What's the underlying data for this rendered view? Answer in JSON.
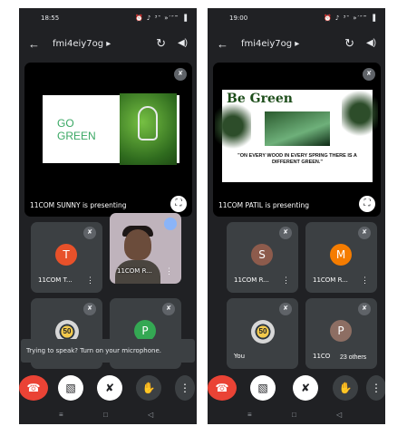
{
  "left": {
    "status": {
      "time": "18:55",
      "indicators": "⏰ ♪ ³‶ »′″‴ ▐"
    },
    "meeting_code": "fmi4eiy7og",
    "slide": {
      "line1": "GO",
      "line2": "GREEN"
    },
    "presenting_caption": "11COM SUNNY is presenting",
    "tiles": [
      {
        "avatar_letter": "T",
        "name": "11COM T...",
        "color": "#e8512a"
      },
      {
        "name": "11COM R...",
        "video": true
      },
      {
        "badge": "50",
        "name": ""
      },
      {
        "avatar_letter": "P",
        "name": "",
        "color": "#34a853"
      }
    ],
    "toast": "Trying to speak? Turn on your microphone."
  },
  "right": {
    "status": {
      "time": "19:00",
      "indicators": "⏰ ♪ ³‶ »′″‴ ▐"
    },
    "meeting_code": "fmi4eiy7og",
    "slide": {
      "title": "Be Green",
      "quote": "\"On every wood in every spring there is a different green.\""
    },
    "presenting_caption": "11COM PATIL is presenting",
    "tiles": [
      {
        "avatar_letter": "S",
        "name": "11COM R...",
        "color": "#8d5b4c"
      },
      {
        "avatar_letter": "M",
        "name": "11COM R...",
        "color": "#f57c00"
      },
      {
        "badge": "50",
        "name": "You"
      },
      {
        "avatar_letter": "P",
        "name": "11CO",
        "color": "#8d6e63",
        "others": "23 others"
      }
    ]
  },
  "icons": {
    "back": "←",
    "caret": "▸",
    "swap": "↻",
    "speaker": "◀)",
    "mic_off": "✘",
    "fullscreen": "⛶",
    "more": "⋮",
    "end": "☎",
    "cam_off": "▧",
    "mic": "✘",
    "hand": "✋",
    "nav_menu": "≡",
    "nav_home": "□",
    "nav_back": "◁"
  },
  "colors": {
    "background": "#202124",
    "tile": "#3c4043",
    "end_call": "#ea4335",
    "go_green": "#3aa864"
  }
}
